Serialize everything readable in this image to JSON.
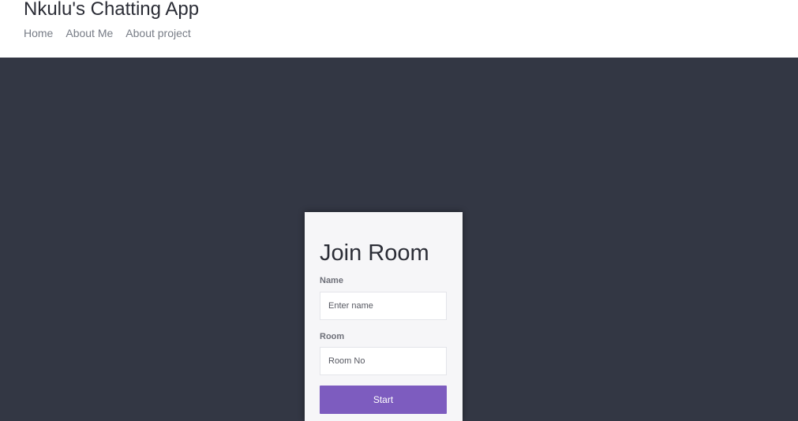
{
  "header": {
    "title": "Nkulu's Chatting App",
    "nav": [
      {
        "label": "Home"
      },
      {
        "label": "About Me"
      },
      {
        "label": "About project"
      }
    ]
  },
  "join_form": {
    "title": "Join Room",
    "name_label": "Name",
    "name_placeholder": "Enter name",
    "name_value": "",
    "room_label": "Room",
    "room_placeholder": "Room No",
    "room_value": "",
    "submit_label": "Start"
  },
  "colors": {
    "background": "#333744",
    "card": "#f6f6f8",
    "accent": "#7d5cbf"
  }
}
